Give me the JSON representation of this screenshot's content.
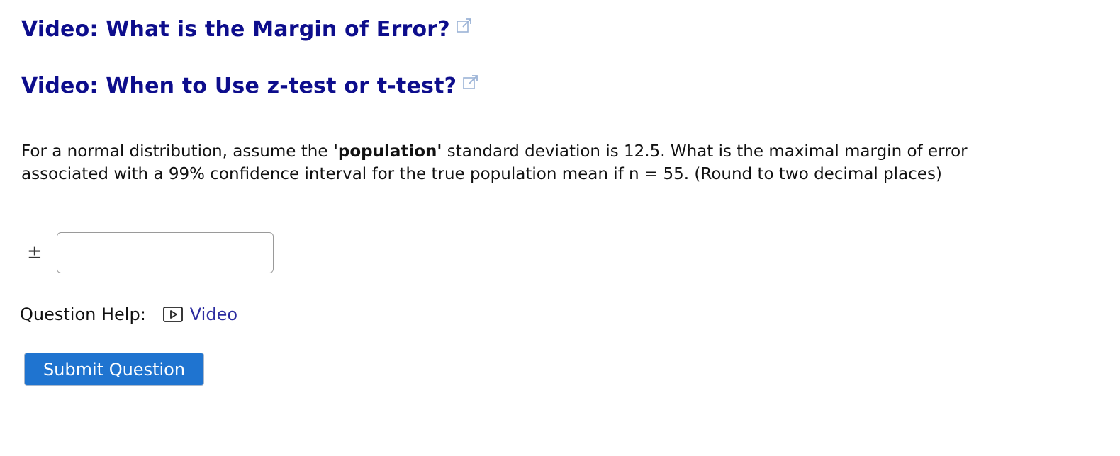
{
  "links": {
    "video1": "Video: What is the Margin of Error?",
    "video2": "Video: When to Use z-test or t-test?"
  },
  "question": {
    "part1": "For a normal distribution, assume the ",
    "bold": "'population'",
    "part2": " standard deviation is 12.5. What is the maximal margin of error associated with a 99% confidence interval for the true population mean if n = 55. (Round to two decimal places)"
  },
  "answer": {
    "prefix": "±",
    "value": "",
    "placeholder": ""
  },
  "help": {
    "label": "Question Help:",
    "video_label": "Video"
  },
  "submit": {
    "label": "Submit Question"
  },
  "colors": {
    "link": "#0d0d8c",
    "button": "#1f74d0",
    "help_link": "#2c2ca0"
  },
  "icons": {
    "external": "external-link-icon",
    "play": "play-video-icon"
  }
}
